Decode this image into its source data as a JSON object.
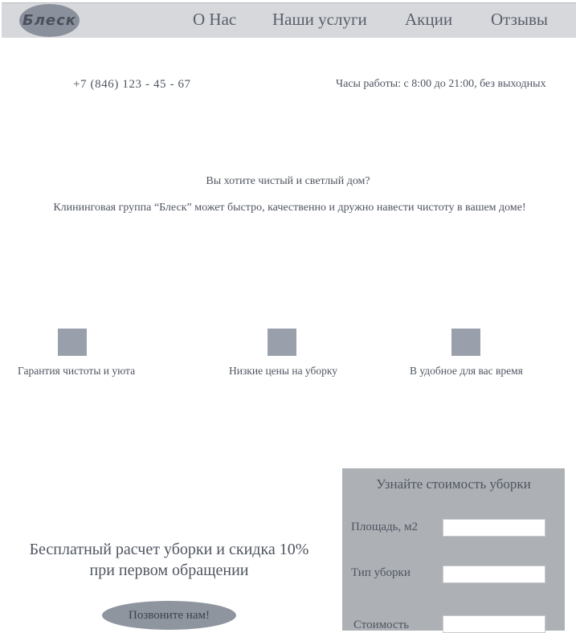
{
  "header": {
    "logo": "Блеск",
    "nav": [
      "О Нас",
      "Наши услуги",
      "Акции",
      "Отзывы"
    ]
  },
  "contacts": {
    "phone": "+7 (846) 123 - 45 - 67",
    "hours": "Часы работы: с 8:00 до 21:00, без выходных"
  },
  "hero": {
    "question": "Вы хотите чистый и светлый дом?",
    "text": "Клининговая группа “Блеск” может быстро, качественно и дружно навести чистоту в вашем доме!"
  },
  "features": [
    {
      "label": "Гарантия чистоты и уюта"
    },
    {
      "label": "Низкие цены на уборку"
    },
    {
      "label": "В удобное для вас время"
    }
  ],
  "promo": {
    "line1": "Бесплатный расчет уборки и скидка 10%",
    "line2": "при первом обращении",
    "button": "Позвоните нам!"
  },
  "calculator": {
    "title": "Узнайте стоимость уборки",
    "area_label": "Площадь, м2",
    "area_value": "",
    "type_label": "Тип уборки",
    "type_value": "",
    "cost_label": "Стоимость",
    "cost_value": ""
  },
  "colors": {
    "nav_bg": "#d7d8dc",
    "logo_bg": "#8b919c",
    "icon_bg": "#9aa0ab",
    "button_bg": "#8f959f",
    "calc_bg": "#adb0b5",
    "text": "#4f5560"
  }
}
